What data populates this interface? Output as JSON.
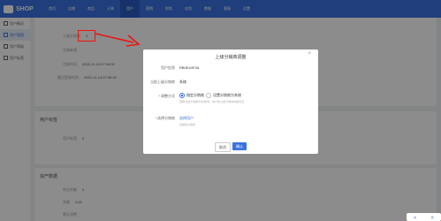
{
  "brand": "SHOP",
  "topnav": [
    "首页",
    "店铺",
    "商品",
    "订单",
    "用户",
    "营销",
    "财务",
    "应用",
    "数据",
    "客服",
    "设置"
  ],
  "sidebar": [
    "用户概况",
    "用户管理",
    "用户等级",
    "用户标签"
  ],
  "profile_rows": [
    {
      "label": "",
      "value": ""
    },
    {
      "label": "上级分销商",
      "value": "0"
    },
    {
      "label": "注册来源",
      "value": ""
    },
    {
      "label": "注册时间",
      "value": "2022-11-14 07:34:32"
    },
    {
      "label": "最后登录时间",
      "value": "2022-11-14 07:35:32"
    },
    {
      "label": "",
      "value": ""
    }
  ],
  "sections": {
    "level": "用户标签",
    "level_row": {
      "label": "用户标签",
      "value": "0"
    },
    "asset": "资产数据",
    "asset_rows": [
      {
        "label": "积分余额",
        "value": "0"
      },
      {
        "label": "余额",
        "value": "0.00"
      },
      {
        "label": "累计消费",
        "value": ""
      }
    ]
  },
  "modal": {
    "title": "上级分销商调整",
    "close": "×",
    "user_label": "用户信息",
    "user_value": "RB0E44F3A",
    "current_label": "当前上级分销商",
    "current_value": "系统",
    "method_label": "* 调整方式",
    "opt1": "指定分销商",
    "opt2": "设置分销商为系统",
    "method_hint": "选择'设置分销商为系统'时，用户的上级分销商将被清空",
    "select_label": "* 选择分销商",
    "select_link": "选择用户",
    "select_hint": "选择的分销商",
    "cancel": "取消",
    "ok": "确认"
  },
  "badge": [
    "中",
    "简"
  ]
}
